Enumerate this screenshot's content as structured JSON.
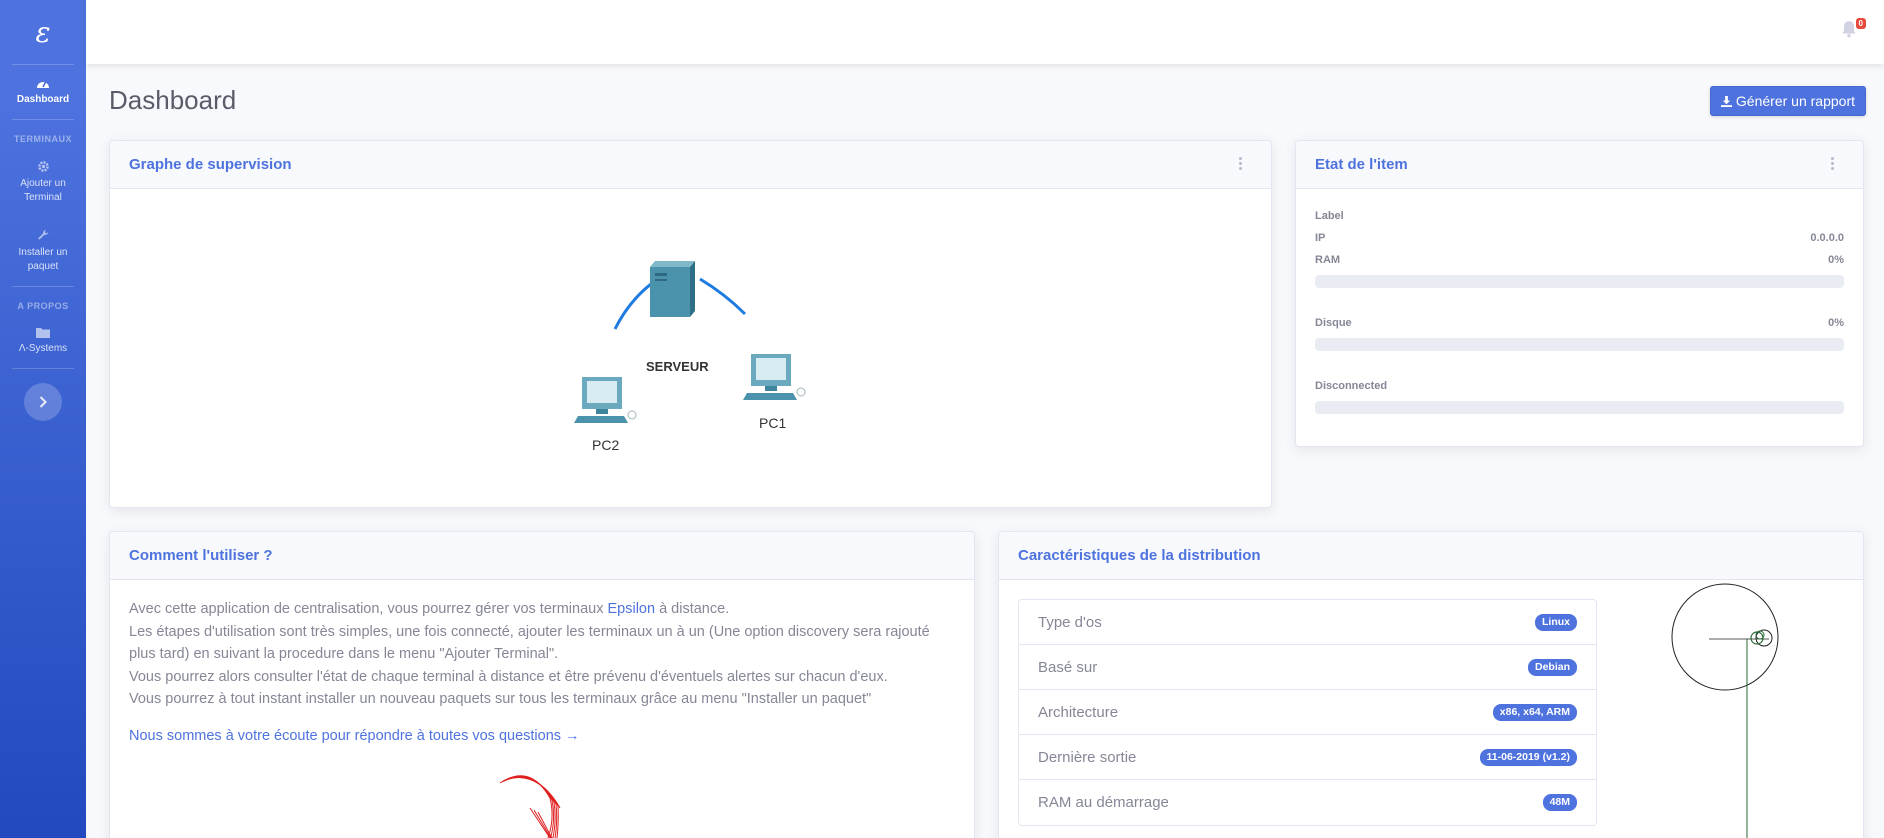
{
  "sidebar": {
    "brand": "ε",
    "items": [
      {
        "label": "Dashboard",
        "icon": "dashboard-icon"
      },
      {
        "label": "Ajouter un Terminal",
        "icon": "gear-icon"
      },
      {
        "label": "Installer un paquet",
        "icon": "wrench-icon"
      },
      {
        "label": "Λ-Systems",
        "icon": "folder-icon"
      }
    ],
    "headings": [
      "TERMINAUX",
      "A PROPOS"
    ]
  },
  "topbar": {
    "notification_count": "0"
  },
  "page": {
    "title": "Dashboard",
    "report_button": "Générer un rapport"
  },
  "supervision": {
    "title": "Graphe de supervision",
    "nodes": {
      "server": "SERVEUR",
      "pc1": "PC1",
      "pc2": "PC2"
    }
  },
  "etat": {
    "title": "Etat de l'item",
    "label": "Label",
    "ip_label": "IP",
    "ip_value": "0.0.0.0",
    "ram_label": "RAM",
    "ram_value": "0%",
    "disk_label": "Disque",
    "disk_value": "0%",
    "status": "Disconnected",
    "ram_fraction": 0,
    "disk_fraction": 0,
    "status_fraction": 0
  },
  "howto": {
    "title": "Comment l'utiliser ?",
    "p1_before": "Avec cette application de centralisation, vous pourrez gérer vos terminaux ",
    "p1_link": "Epsilon",
    "p1_after": " à distance.",
    "p2": "Les étapes d'utilisation sont très simples, une fois connecté, ajouter les terminaux un à un (Une option discovery sera rajouté plus tard) en suivant la procedure dans le menu \"Ajouter Terminal\".",
    "p3": "Vous pourrez alors consulter l'état de chaque terminal à distance et être prévenu d'éventuels alertes sur chacun d'eux.",
    "p4": "Vous pourrez à tout instant installer un nouveau paquets sur tous les terminaux grâce au menu \"Installer un paquet\"",
    "cta": "Nous sommes à votre écoute pour répondre à toutes vos questions →"
  },
  "distribution": {
    "title": "Caractéristiques de la distribution",
    "rows": [
      {
        "label": "Type d'os",
        "value": "Linux"
      },
      {
        "label": "Basé sur",
        "value": "Debian"
      },
      {
        "label": "Architecture",
        "value": "x86, x64, ARM"
      },
      {
        "label": "Dernière sortie",
        "value": "11-06-2019 (v1.2)"
      },
      {
        "label": "RAM au démarrage",
        "value": "48M"
      }
    ]
  },
  "colors": {
    "primary": "#4e73df",
    "danger": "#e74a3b",
    "bg": "#f8f9fc"
  }
}
